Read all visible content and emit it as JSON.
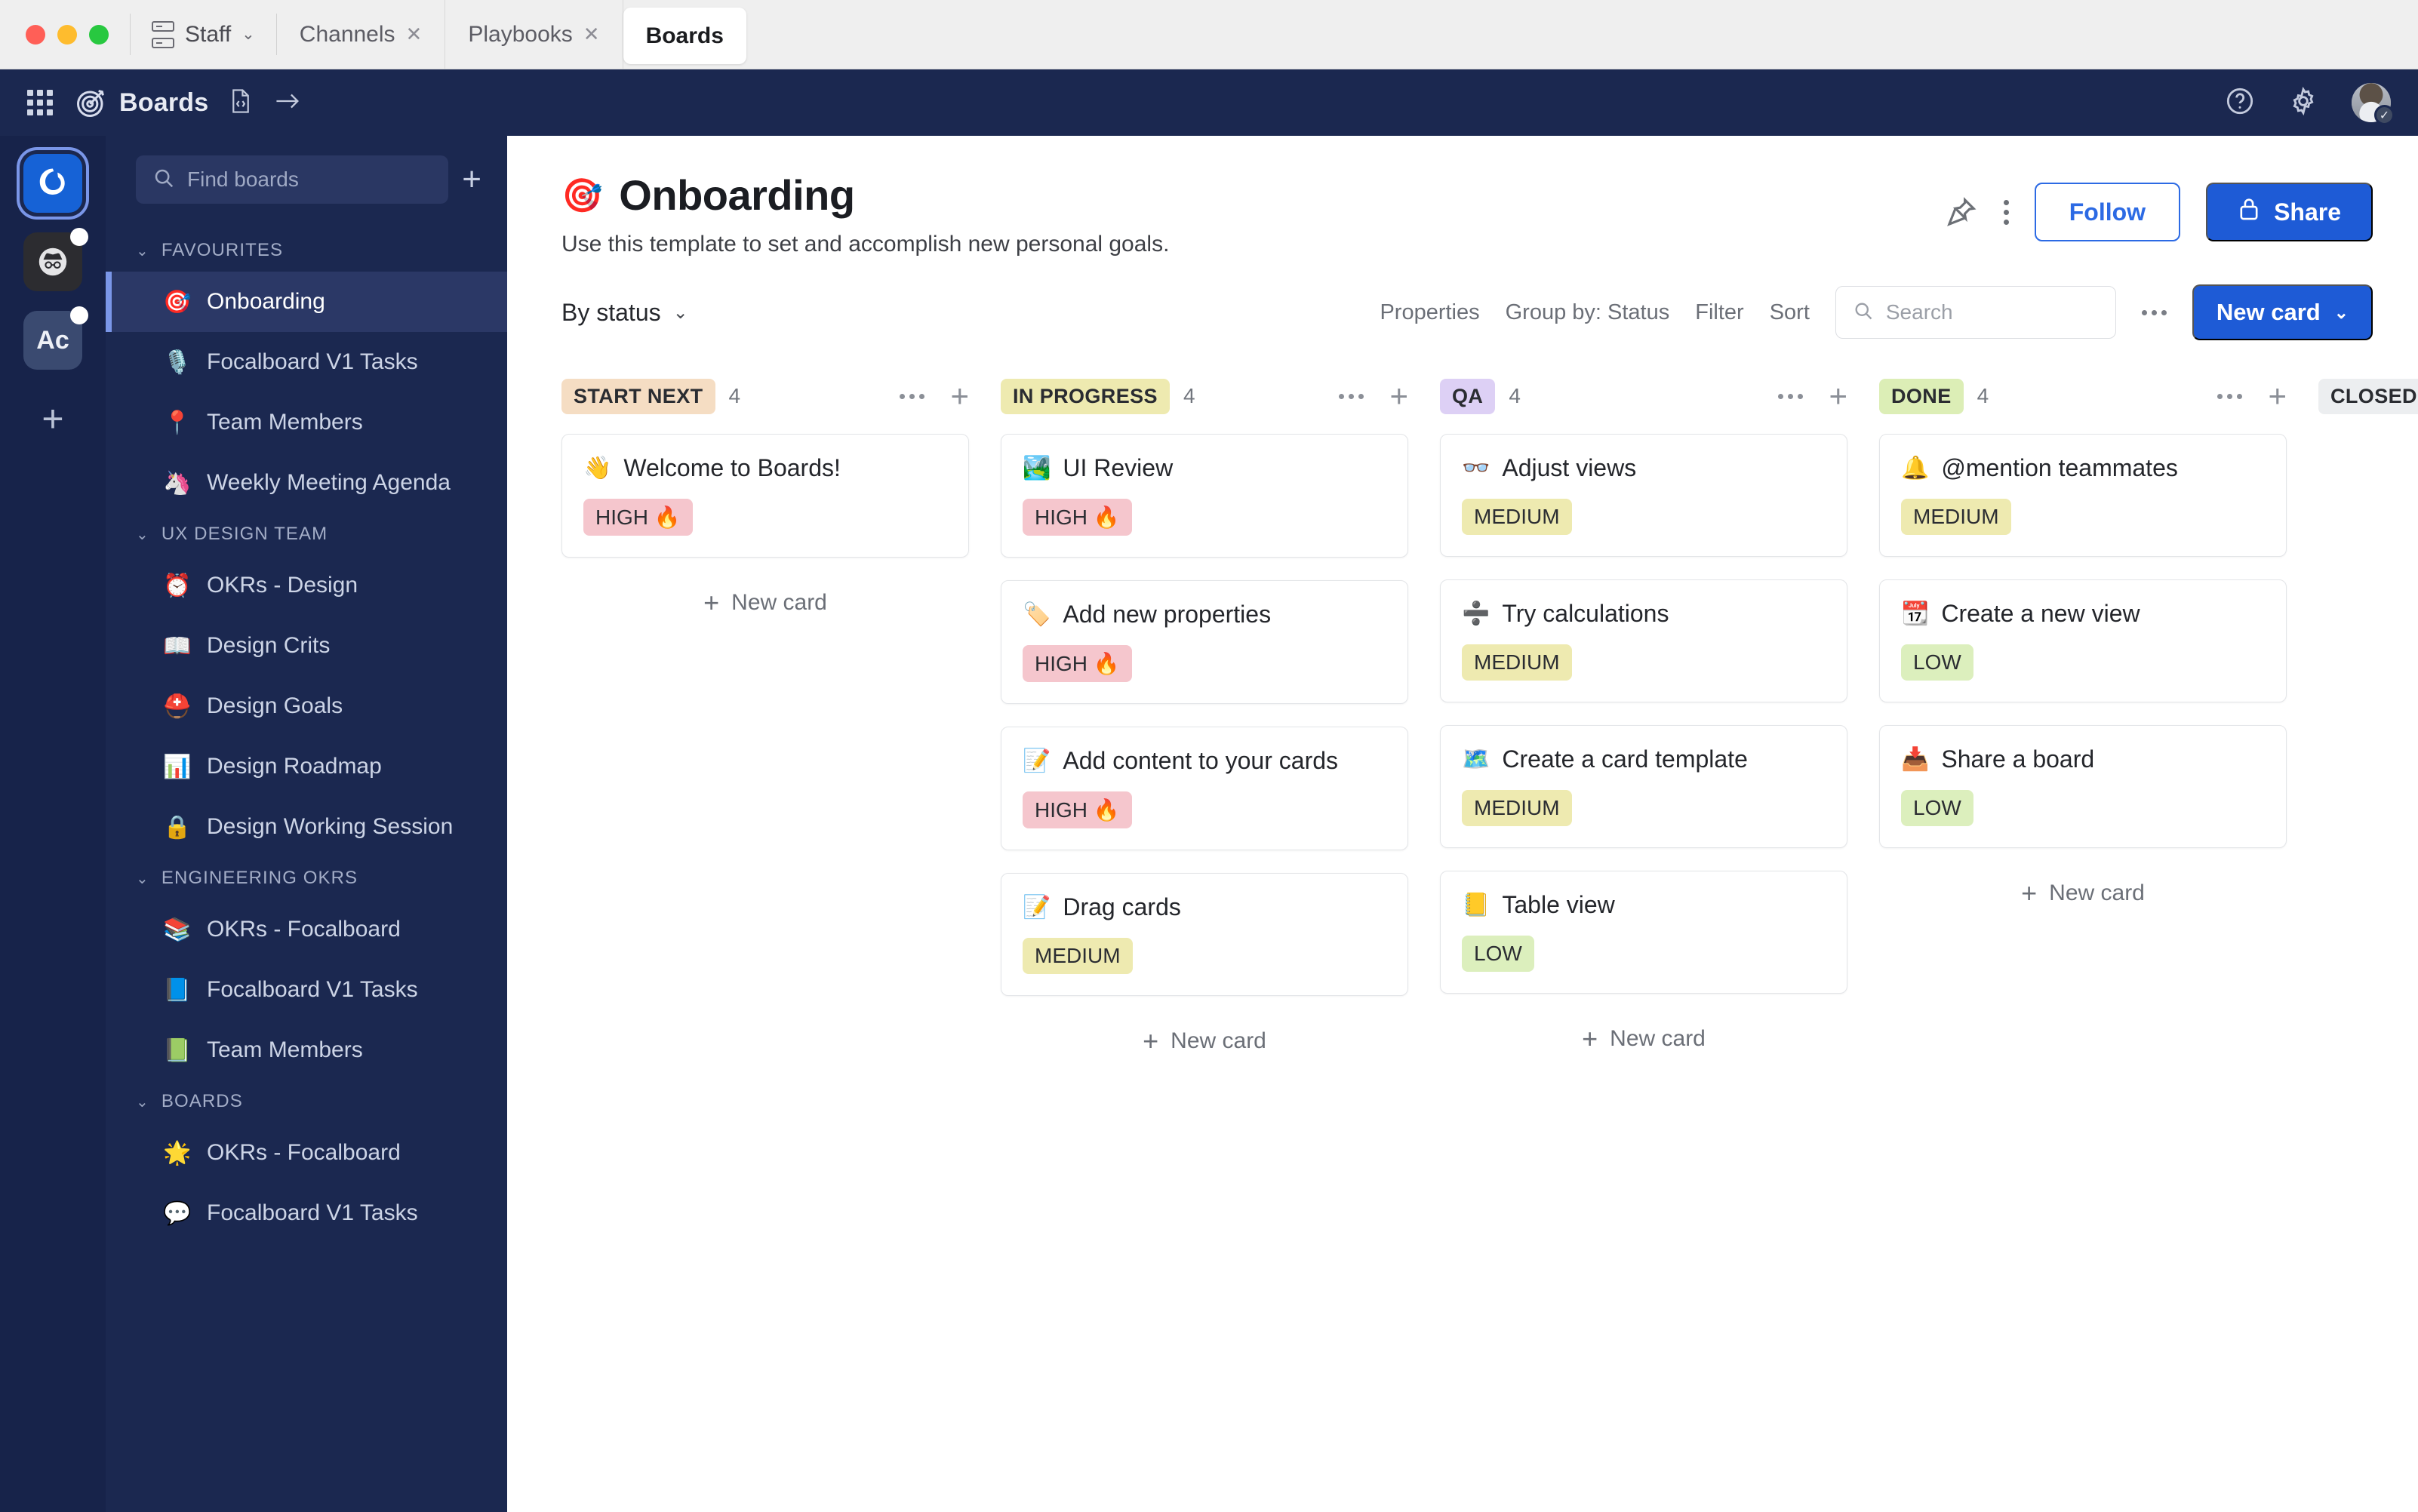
{
  "window": {
    "workspace_tab": "Staff",
    "tabs": [
      {
        "label": "Channels",
        "closable": true,
        "active": false
      },
      {
        "label": "Playbooks",
        "closable": true,
        "active": false
      },
      {
        "label": "Boards",
        "closable": false,
        "active": true
      }
    ]
  },
  "global_header": {
    "brand": "Boards",
    "icons": [
      "grid-icon",
      "boards-target-icon",
      "file-code-icon",
      "arrow-right-icon",
      "help-icon",
      "gear-icon",
      "avatar"
    ]
  },
  "rail": {
    "teams": [
      {
        "name": "mattermost-team",
        "label": "",
        "active": true,
        "badge": false
      },
      {
        "name": "incognito-team",
        "label": "",
        "active": false,
        "badge": true
      },
      {
        "name": "ac-team",
        "label": "Ac",
        "active": false,
        "badge": true
      },
      {
        "name": "add-team",
        "label": "+",
        "active": false,
        "badge": false
      }
    ]
  },
  "sidebar": {
    "search_placeholder": "Find boards",
    "add_board_label": "+",
    "groups": [
      {
        "title": "FAVOURITES",
        "items": [
          {
            "emoji": "🎯",
            "label": "Onboarding",
            "selected": true
          },
          {
            "emoji": "🎙️",
            "label": "Focalboard V1 Tasks",
            "selected": false
          },
          {
            "emoji": "📍",
            "label": "Team Members",
            "selected": false
          },
          {
            "emoji": "🦄",
            "label": "Weekly Meeting Agenda",
            "selected": false
          }
        ]
      },
      {
        "title": "UX DESIGN TEAM",
        "items": [
          {
            "emoji": "⏰",
            "label": "OKRs - Design",
            "selected": false
          },
          {
            "emoji": "📖",
            "label": "Design Crits",
            "selected": false
          },
          {
            "emoji": "⛑️",
            "label": "Design Goals",
            "selected": false
          },
          {
            "emoji": "📊",
            "label": "Design Roadmap",
            "selected": false
          },
          {
            "emoji": "🔒",
            "label": "Design Working Session",
            "selected": false
          }
        ]
      },
      {
        "title": "ENGINEERING OKRS",
        "items": [
          {
            "emoji": "📚",
            "label": "OKRs - Focalboard",
            "selected": false
          },
          {
            "emoji": "📘",
            "label": "Focalboard V1 Tasks",
            "selected": false
          },
          {
            "emoji": "📗",
            "label": "Team Members",
            "selected": false
          }
        ]
      },
      {
        "title": "BOARDS",
        "items": [
          {
            "emoji": "🌟",
            "label": "OKRs - Focalboard",
            "selected": false
          },
          {
            "emoji": "💬",
            "label": "Focalboard V1 Tasks",
            "selected": false
          }
        ]
      }
    ]
  },
  "page": {
    "emoji": "🎯",
    "title": "Onboarding",
    "subtitle": "Use this template to set and accomplish new personal goals.",
    "follow_label": "Follow",
    "share_label": "Share"
  },
  "toolbar": {
    "view_name": "By status",
    "properties_label": "Properties",
    "group_by_label": "Group by: Status",
    "filter_label": "Filter",
    "sort_label": "Sort",
    "search_placeholder": "Search",
    "new_card_label": "New card"
  },
  "board": {
    "new_card_label": "New card",
    "columns": [
      {
        "name": "START NEXT",
        "count": "4",
        "chip_color": "orange",
        "show_new_card": true,
        "cards": [
          {
            "emoji": "👋",
            "title": "Welcome to Boards!",
            "priority": "HIGH 🔥",
            "priority_class": "high"
          }
        ]
      },
      {
        "name": "IN PROGRESS",
        "count": "4",
        "chip_color": "yellow",
        "show_new_card": true,
        "cards": [
          {
            "emoji": "🏞️",
            "title": "UI Review",
            "priority": "HIGH 🔥",
            "priority_class": "high"
          },
          {
            "emoji": "🏷️",
            "title": "Add new properties",
            "priority": "HIGH 🔥",
            "priority_class": "high"
          },
          {
            "emoji": "📝",
            "title": "Add content to your cards",
            "priority": "HIGH 🔥",
            "priority_class": "high"
          },
          {
            "emoji": "📝",
            "title": "Drag cards",
            "priority": "MEDIUM",
            "priority_class": "medium"
          }
        ]
      },
      {
        "name": "QA",
        "count": "4",
        "chip_color": "purple",
        "show_new_card": true,
        "cards": [
          {
            "emoji": "👓",
            "title": "Adjust views",
            "priority": "MEDIUM",
            "priority_class": "medium"
          },
          {
            "emoji": "➗",
            "title": "Try calculations",
            "priority": "MEDIUM",
            "priority_class": "medium"
          },
          {
            "emoji": "🗺️",
            "title": "Create a card template",
            "priority": "MEDIUM",
            "priority_class": "medium"
          },
          {
            "emoji": "📒",
            "title": "Table view",
            "priority": "LOW",
            "priority_class": "low"
          }
        ]
      },
      {
        "name": "DONE",
        "count": "4",
        "chip_color": "green",
        "show_new_card": true,
        "cards": [
          {
            "emoji": "🔔",
            "title": "@mention teammates",
            "priority": "MEDIUM",
            "priority_class": "medium"
          },
          {
            "emoji": "📆",
            "title": "Create a new view",
            "priority": "LOW",
            "priority_class": "low"
          },
          {
            "emoji": "📥",
            "title": "Share a board",
            "priority": "LOW",
            "priority_class": "low"
          }
        ]
      },
      {
        "name": "CLOSED",
        "count": "",
        "chip_color": "grey",
        "show_new_card": false,
        "cards": []
      }
    ]
  },
  "colors": {
    "accent_blue": "#1e5bd6",
    "sidebar_navy": "#1b2850",
    "rail_navy": "#17234a",
    "selected_item": "#2b3866"
  }
}
